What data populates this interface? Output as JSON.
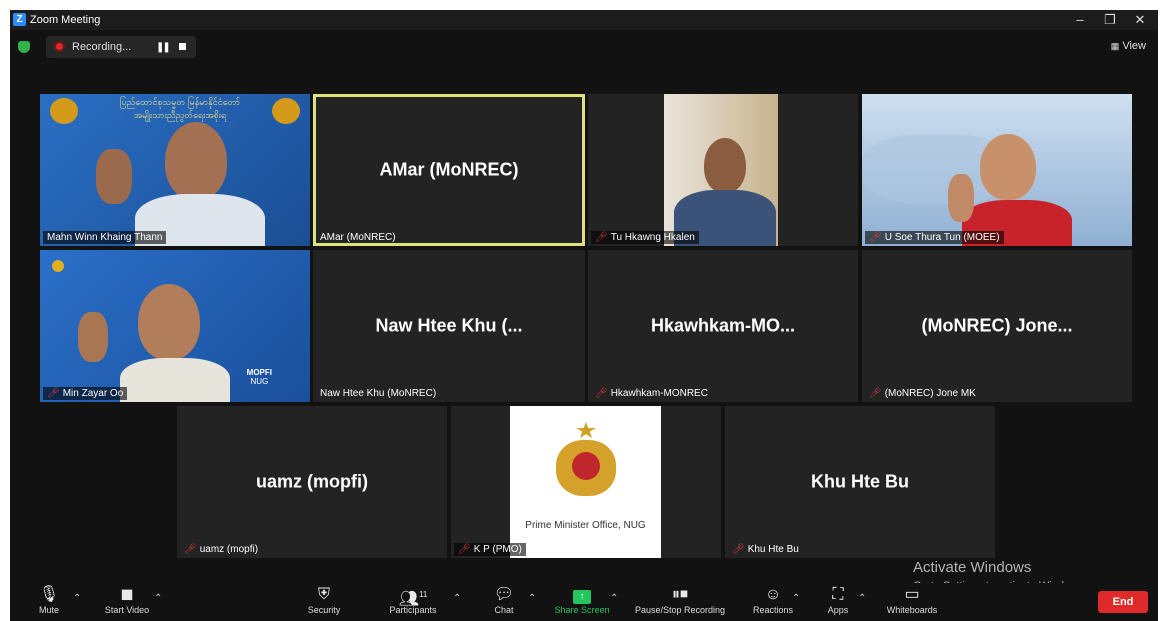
{
  "window": {
    "app_title": "Zoom Meeting",
    "minimize": "–",
    "maximize": "❐",
    "close": "✕"
  },
  "top": {
    "recording_label": "Recording...",
    "pause_icon": "❚❚",
    "view_label": "View",
    "view_icon": "grid-icon"
  },
  "tiles": [
    {
      "label": "Mahn Winn Khaing Thann",
      "big": "",
      "muted": false
    },
    {
      "label": "AMar (MoNREC)",
      "big": "AMar (MoNREC)",
      "muted": false,
      "active": true
    },
    {
      "label": "Tu Hkawng Hkalen",
      "big": "",
      "muted": true
    },
    {
      "label": "U Soe Thura Tun (MOEE)",
      "big": "",
      "muted": true
    },
    {
      "label": "Min Zayar Oo",
      "big": "",
      "muted": true
    },
    {
      "label": "Naw Htee Khu (MoNREC)",
      "big": "Naw Htee Khu (...",
      "muted": false
    },
    {
      "label": "Hkawhkam-MONREC",
      "big": "Hkawhkam-MO...",
      "muted": true
    },
    {
      "label": "(MoNREC) Jone MK",
      "big": "(MoNREC)  Jone...",
      "muted": true
    },
    {
      "label": "uamz (mopfi)",
      "big": "uamz (mopfi)",
      "muted": true
    },
    {
      "label": "K P (PMO)",
      "big": "",
      "muted": true,
      "caption": "Prime Minister Office, NUG"
    },
    {
      "label": "Khu Hte Bu",
      "big": "Khu Hte Bu",
      "muted": true
    }
  ],
  "banner": {
    "tile1_text_line1": "ပြည်ထောင်စုသမ္မတ မြန်မာနိုင်ငံတော်",
    "tile1_text_line2": "အမျိုးသားညီညွတ်ရေးအစိုးရ",
    "tile5_corner": "MOPFI",
    "tile5_corner2": "NUG"
  },
  "toolbar": {
    "mute": "Mute",
    "start_video": "Start Video",
    "security": "Security",
    "participants": "Participants",
    "participants_count": "11",
    "chat": "Chat",
    "share_screen": "Share Screen",
    "pause_stop_recording": "Pause/Stop Recording",
    "reactions": "Reactions",
    "apps": "Apps",
    "whiteboards": "Whiteboards",
    "end": "End"
  },
  "watermark": {
    "title": "Activate Windows",
    "subtitle": "Go to Settings to activate Windows."
  },
  "colors": {
    "active_border": "#dde27a",
    "share_green": "#22c55e",
    "end_red": "#e02a2a",
    "record_red": "#e02828"
  }
}
